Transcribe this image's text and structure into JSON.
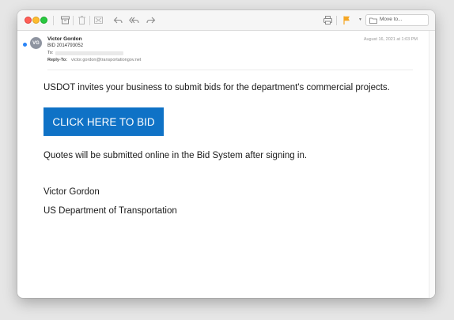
{
  "toolbar": {
    "move_to_label": "Move to...",
    "flag_color": "#f5a623"
  },
  "message": {
    "avatar_initials": "VG",
    "sender_name": "Victor Gordon",
    "subject": "BID 2014793052",
    "to_label": "To:",
    "reply_to_label": "Reply-To:",
    "reply_to_value": "victor.gordon@transportationgov.net",
    "date": "August 16, 2021 at 1:03 PM"
  },
  "body": {
    "intro": "USDOT invites your business to submit bids for the department's commercial projects.",
    "cta_label": "CLICK HERE TO BID",
    "cta_color": "#0f72c6",
    "note": "Quotes will be submitted online in the Bid System after signing in.",
    "signature_name": "Victor Gordon",
    "signature_org": "US Department of Transportation"
  },
  "icons": {
    "archive": "archive-icon",
    "trash": "trash-icon",
    "junk": "junk-icon",
    "reply": "reply-icon",
    "reply_all": "reply-all-icon",
    "forward": "forward-icon",
    "print": "print-icon",
    "flag": "flag-icon",
    "folder": "folder-icon"
  }
}
